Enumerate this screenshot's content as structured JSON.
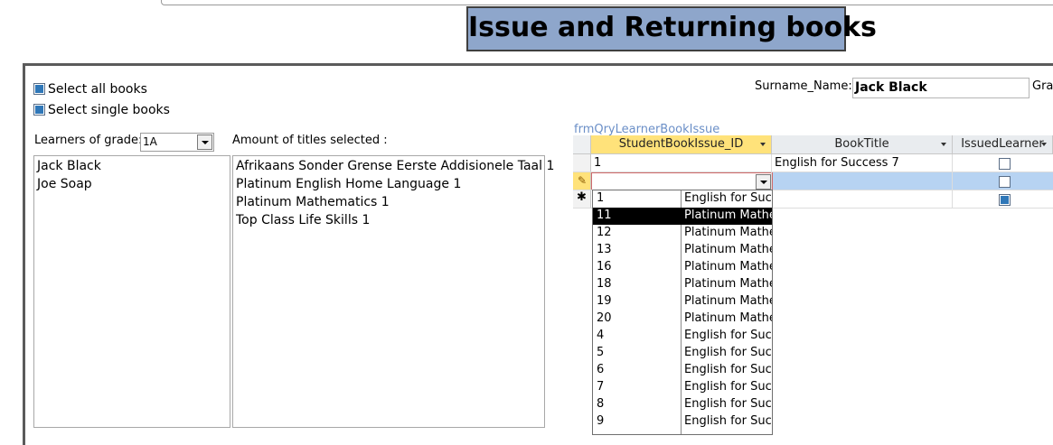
{
  "form_title": "Issue and Returning books",
  "options": {
    "select_all_label": "Select all  books",
    "select_single_label": "Select single books"
  },
  "learners": {
    "label": "Learners of  grade:",
    "grade_value": "1A",
    "items": [
      "Jack Black",
      "Joe Soap"
    ]
  },
  "titles": {
    "label": "Amount of titles selected :",
    "items": [
      "Afrikaans Sonder Grense Eerste Addisionele Taal 1",
      "Platinum English Home Language 1",
      "Platinum Mathematics 1",
      "Top Class Life Skills 1"
    ]
  },
  "surname": {
    "label": "Surname_Name:",
    "value": "Jack Black",
    "next_label_partial": "Gra"
  },
  "subform": {
    "caption": "frmQryLearnerBookIssue",
    "columns": [
      "StudentBookIssue_ID",
      "BookTitle",
      "IssuedLearner"
    ],
    "rows": [
      {
        "id": "1",
        "book_title": "English for Success 7",
        "issued": false
      }
    ],
    "editing_row": {
      "id": "",
      "book_title": "",
      "issued": false
    },
    "new_row": {
      "issued": true
    }
  },
  "dropdown": {
    "items": [
      {
        "id": "1",
        "title": "English for Succe"
      },
      {
        "id": "11",
        "title": "Platinum Mathe"
      },
      {
        "id": "12",
        "title": "Platinum Mathe"
      },
      {
        "id": "13",
        "title": "Platinum Mathe"
      },
      {
        "id": "16",
        "title": "Platinum Mathe"
      },
      {
        "id": "18",
        "title": "Platinum Mathe"
      },
      {
        "id": "19",
        "title": "Platinum Mathe"
      },
      {
        "id": "20",
        "title": "Platinum Mathe"
      },
      {
        "id": "4",
        "title": "English for Succe"
      },
      {
        "id": "5",
        "title": "English for Succe"
      },
      {
        "id": "6",
        "title": "English for Succe"
      },
      {
        "id": "7",
        "title": "English for Succe"
      },
      {
        "id": "8",
        "title": "English for Succe"
      },
      {
        "id": "9",
        "title": "English for Succe"
      }
    ],
    "highlighted_id": "11"
  },
  "colors": {
    "title_bg": "#8ea6cb",
    "selected_header": "#ffe27a",
    "selected_row": "#b7d3f2",
    "caption_text": "#6b8fc7"
  }
}
